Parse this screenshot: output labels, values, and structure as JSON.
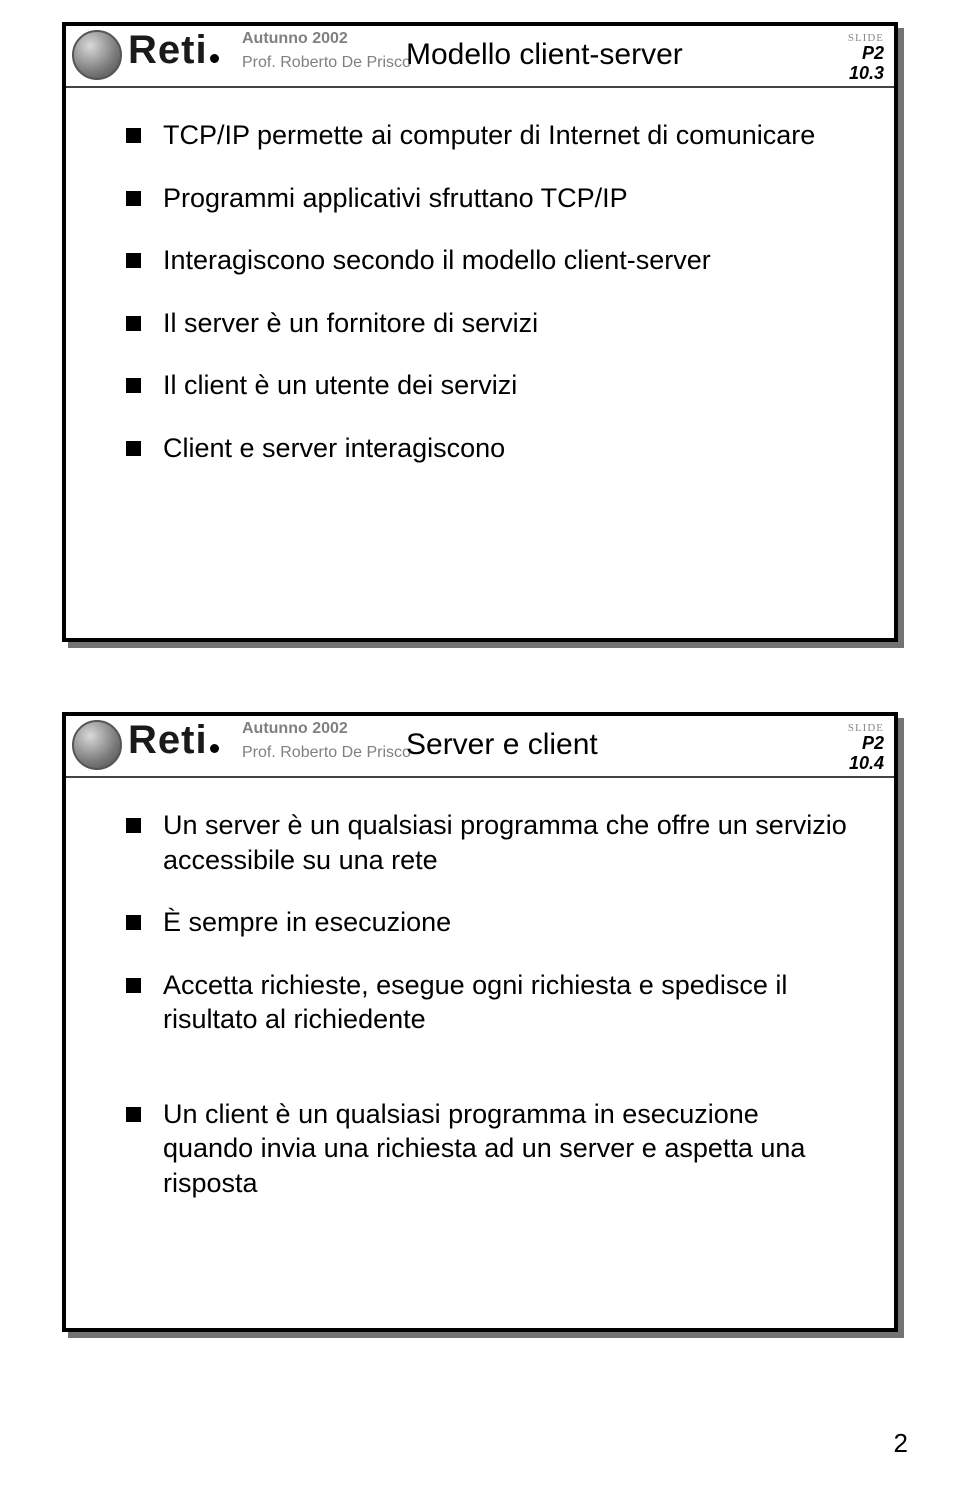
{
  "brand": {
    "logo_text": "Reti",
    "term": "Autunno 2002",
    "prof": "Prof. Roberto De Prisco",
    "slide_word": "SLIDE",
    "p_label": "P2"
  },
  "slide1": {
    "title": "Modello client-server",
    "page_num": "10.3",
    "bullets": [
      "TCP/IP permette ai computer di Internet di comunicare",
      "Programmi applicativi sfruttano TCP/IP",
      "Interagiscono secondo il modello client-server",
      "Il server è un fornitore di servizi",
      "Il client è un utente dei servizi",
      "Client e server interagiscono"
    ]
  },
  "slide2": {
    "title": "Server e client",
    "page_num": "10.4",
    "bullets_a": [
      "Un server è un qualsiasi programma che offre un servizio accessibile su una rete",
      "È sempre in esecuzione",
      "Accetta richieste, esegue ogni richiesta e spedisce il risultato al richiedente"
    ],
    "bullets_b": [
      "Un client è un qualsiasi programma in esecuzione quando invia una richiesta ad un server e aspetta una risposta"
    ]
  },
  "page_footer": "2"
}
